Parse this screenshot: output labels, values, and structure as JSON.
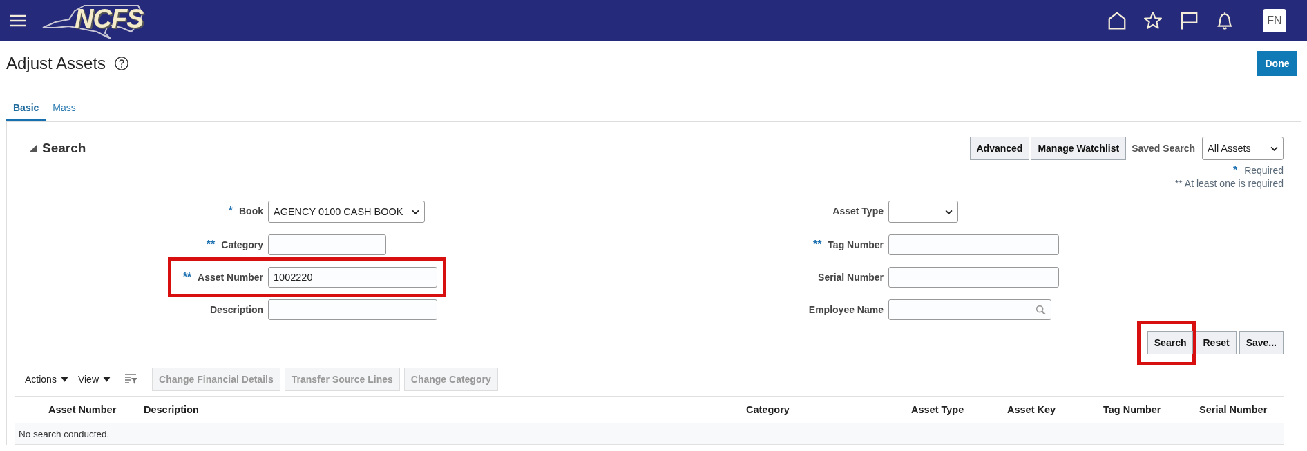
{
  "header": {
    "logo_text": "NCFS",
    "avatar": "FN"
  },
  "page": {
    "title": "Adjust Assets",
    "done_button": "Done"
  },
  "tabs": [
    {
      "label": "Basic",
      "selected": true
    },
    {
      "label": "Mass",
      "selected": false
    }
  ],
  "search": {
    "title": "Search",
    "expanded": true,
    "buttons": [
      "Advanced",
      "Manage Watchlist"
    ],
    "saved_search": {
      "label": "Saved Search",
      "value": "All Assets"
    },
    "required_note": {
      "marker": "*",
      "text": "Required"
    },
    "at_least_one_note": "** At least one is required",
    "fields_left": [
      {
        "label": "Book",
        "required": "*",
        "kind": "select",
        "value": "AGENCY 0100 CASH BOOK",
        "highlighted": false
      },
      {
        "label": "Category",
        "required": "**",
        "kind": "text",
        "highlighted": false
      },
      {
        "label": "Asset Number",
        "required": "**",
        "kind": "text",
        "value": "1002220",
        "highlighted": true
      },
      {
        "label": "Description",
        "kind": "text",
        "highlighted": false
      }
    ],
    "fields_right": [
      {
        "label": "Asset Type",
        "kind": "select",
        "highlighted": false
      },
      {
        "label": "Tag Number",
        "required": "**",
        "kind": "text",
        "highlighted": false
      },
      {
        "label": "Serial Number",
        "kind": "text",
        "highlighted": false
      },
      {
        "label": "Employee Name",
        "kind": "search",
        "highlighted": false
      }
    ],
    "actions": [
      {
        "label": "Search",
        "highlighted": true
      },
      {
        "label": "Reset",
        "highlighted": false
      },
      {
        "label": "Save...",
        "highlighted": false
      }
    ]
  },
  "results": {
    "menus": [
      "Actions",
      "View"
    ],
    "buttons": [
      {
        "label": "Change Financial Details",
        "disabled": true
      },
      {
        "label": "Transfer Source Lines",
        "disabled": true
      },
      {
        "label": "Change Category",
        "disabled": true
      }
    ],
    "columns": [
      "Asset Number",
      "Description",
      "Category",
      "Asset Type",
      "Asset Key",
      "Tag Number",
      "Serial Number"
    ],
    "empty_message": "No search conducted."
  }
}
